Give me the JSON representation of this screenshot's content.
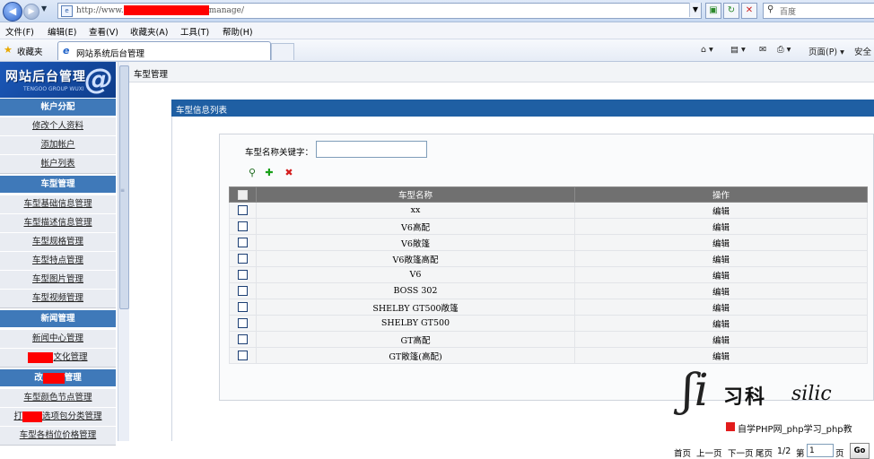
{
  "browser": {
    "url_prefix": "http://www.",
    "url_suffix": "manage/",
    "search_placeholder": "百度",
    "menu": [
      "文件(F)",
      "编辑(E)",
      "查看(V)",
      "收藏夹(A)",
      "工具(T)",
      "帮助(H)"
    ],
    "favorites_label": "收藏夹",
    "tab_title": "网站系统后台管理",
    "commands": {
      "page": "页面(P) ▾",
      "safety": "安全"
    }
  },
  "logo": {
    "title": "网站后台管理",
    "subtitle": "TENGOO GROUP WUXI"
  },
  "sidebar": {
    "groups": [
      {
        "title": "帐户分配",
        "items": [
          "修改个人资料",
          "添加帐户",
          "帐户列表"
        ]
      },
      {
        "title": "车型管理",
        "items": [
          "车型基础信息管理",
          "车型描述信息管理",
          "车型规格管理",
          "车型特点管理",
          "车型图片管理",
          "车型视频管理"
        ]
      },
      {
        "title": "新闻管理",
        "items": [
          "新闻中心管理",
          "文化管理"
        ]
      },
      {
        "title_pre": "改",
        "title_post": "管理",
        "items": [
          "车型颜色节点管理",
          "打",
          "车型各档位价格管理"
        ]
      }
    ],
    "item_extra": {
      "option_pkg_post": "选项包分类管理"
    }
  },
  "main": {
    "breadcrumb": "车型管理",
    "panel_title": "车型信息列表",
    "keyword_label": "车型名称关键字：",
    "keyword_value": "",
    "table": {
      "headers": [
        "车型名称",
        "操作"
      ],
      "rows": [
        {
          "name": "xx",
          "op": "编辑"
        },
        {
          "name": "V6高配",
          "op": "编辑"
        },
        {
          "name": "V6敞篷",
          "op": "编辑"
        },
        {
          "name": "V6敞篷高配",
          "op": "编辑"
        },
        {
          "name": "V6",
          "op": "编辑"
        },
        {
          "name": "BOSS 302",
          "op": "编辑"
        },
        {
          "name": "SHELBY GT500敞篷",
          "op": "编辑"
        },
        {
          "name": "SHELBY GT500",
          "op": "编辑"
        },
        {
          "name": "GT高配",
          "op": "编辑"
        },
        {
          "name": "GT敞篷(高配)",
          "op": "编辑"
        }
      ]
    },
    "pager": {
      "first": "首页",
      "prev": "上一页",
      "next": "下一页",
      "last": "尾页",
      "status": "1/2",
      "goto_pre": "第",
      "page_value": "1",
      "goto_post": "页",
      "go": "Go"
    }
  },
  "watermark": {
    "cn": "习科",
    "en": "silic",
    "bar": "自学PHP网_php学习_php教"
  }
}
